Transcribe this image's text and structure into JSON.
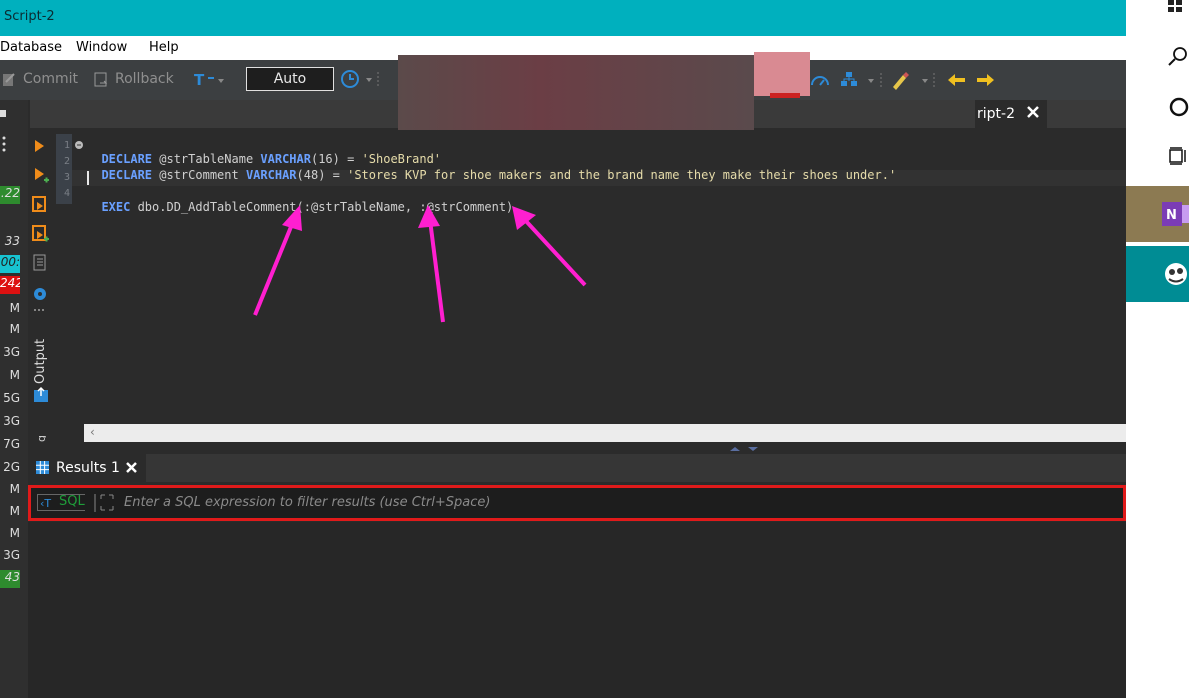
{
  "window": {
    "title": "Script-2"
  },
  "menu": {
    "items": [
      "Database",
      "Window",
      "Help"
    ]
  },
  "toolbar": {
    "commit_label": "Commit",
    "rollback_label": "Rollback",
    "tx_mode": "Auto"
  },
  "editor_tab": {
    "label": "ript-2"
  },
  "editor": {
    "lines": [
      {
        "num": "1",
        "parts": [
          [
            "kw",
            "DECLARE"
          ],
          [
            "txt",
            " @strTableName "
          ],
          [
            "kw",
            "VARCHAR"
          ],
          [
            "txt",
            "(16) = "
          ],
          [
            "str",
            "'ShoeBrand'"
          ]
        ]
      },
      {
        "num": "2",
        "parts": [
          [
            "kw",
            "DECLARE"
          ],
          [
            "txt",
            " @strComment "
          ],
          [
            "kw",
            "VARCHAR"
          ],
          [
            "txt",
            "(48) = "
          ],
          [
            "str",
            "'Stores KVP for shoe makers and the brand name they make their shoes under.'"
          ]
        ]
      },
      {
        "num": "3",
        "parts": []
      },
      {
        "num": "4",
        "parts": [
          [
            "kw",
            "EXEC"
          ],
          [
            "txt",
            " dbo.DD_AddTableComment(:@strTableName, :@strComment)"
          ]
        ]
      }
    ]
  },
  "left_panel": {
    "output_label": "Output",
    "values": [
      ".22",
      "33",
      "00:",
      "242",
      "M",
      "M",
      "3G",
      "M",
      "5G",
      "3G",
      "7G",
      "2G",
      "M",
      "M",
      "M",
      "3G",
      "43"
    ]
  },
  "results": {
    "tab_label": "Results 1",
    "sql_label": "SQL",
    "filter_placeholder": "Enter a SQL expression to filter results (use Ctrl+Space)"
  },
  "colors": {
    "titlebar": "#00b0be",
    "annotation_arrow": "#ff1fd0",
    "filter_outline": "#e01a1a"
  }
}
